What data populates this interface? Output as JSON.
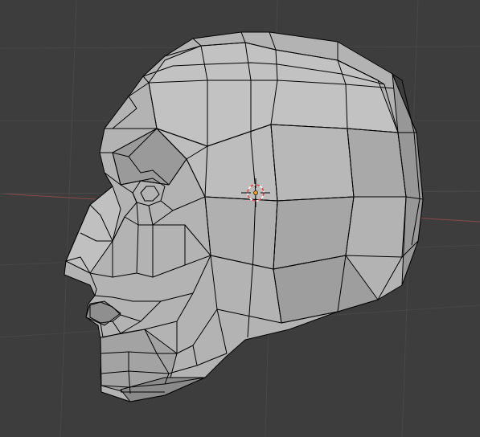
{
  "viewport": {
    "background": "#3d3d3d",
    "grid_color": "#474747",
    "x_axis_color": "#8a4a4a",
    "y_axis_color": "#5e7a3a"
  },
  "mesh": {
    "object": "head",
    "shading": "solid",
    "base_color": "#b3b3b3",
    "highlight_color": "#c8c8c8",
    "shadow_color": "#8c8c8c",
    "wire_color": "#000000"
  },
  "cursor_3d": {
    "icon": "3d-cursor-icon",
    "ring_red": "#e04040",
    "ring_white": "#ffffff",
    "crosshair_color": "#000000"
  },
  "origin": {
    "icon": "object-origin-icon",
    "color": "#f0a020"
  }
}
